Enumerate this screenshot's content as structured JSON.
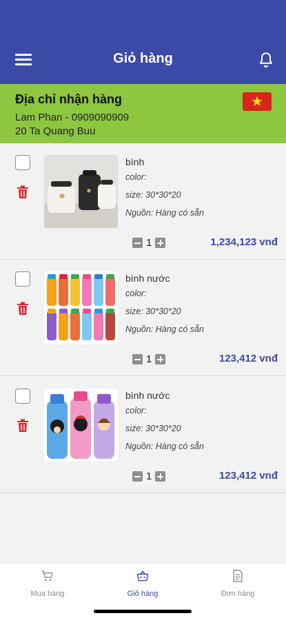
{
  "header": {
    "title": "Giỏ hàng",
    "menu_icon": "hamburger-menu-icon",
    "notification_icon": "bell-icon",
    "background_color": "#3b4aa6"
  },
  "address": {
    "title": "Địa chỉ nhận hàng",
    "recipient": "Lam Phan - 0909090909",
    "street": "20 Ta Quang Buu",
    "flag_icon": "vietnam-flag-icon",
    "background_color": "#8dc63f"
  },
  "cart_items": [
    {
      "name": "bình",
      "color_label": "color:",
      "size_label": "size:  30*30*20",
      "source_label": "Nguồn: Hàng có sẵn",
      "quantity": "1",
      "price": "1,234,123 vnđ",
      "image": "black-white-ceramic-jars"
    },
    {
      "name": "bình nước",
      "color_label": "color:",
      "size_label": "size:  30*30*20",
      "source_label": "Nguồn: Hàng có sẵn",
      "quantity": "1",
      "price": "123,412 vnđ",
      "image": "kids-water-bottles-set"
    },
    {
      "name": "bình nước",
      "color_label": "color:",
      "size_label": "size:  30*30*20",
      "source_label": "Nguồn: Hàng có sẵn",
      "quantity": "1",
      "price": "123,412 vnđ",
      "image": "character-water-bottles"
    }
  ],
  "tabbar": {
    "tabs": [
      {
        "label": "Mua hàng",
        "icon": "cart-icon",
        "active": false
      },
      {
        "label": "Giỏ hàng",
        "icon": "basket-icon",
        "active": true
      },
      {
        "label": "Đơn hàng",
        "icon": "document-icon",
        "active": false
      }
    ],
    "active_color": "#3b4aa6",
    "inactive_color": "#8a8a8a"
  },
  "colors": {
    "price": "#3b4aa6",
    "delete": "#d9272e"
  }
}
